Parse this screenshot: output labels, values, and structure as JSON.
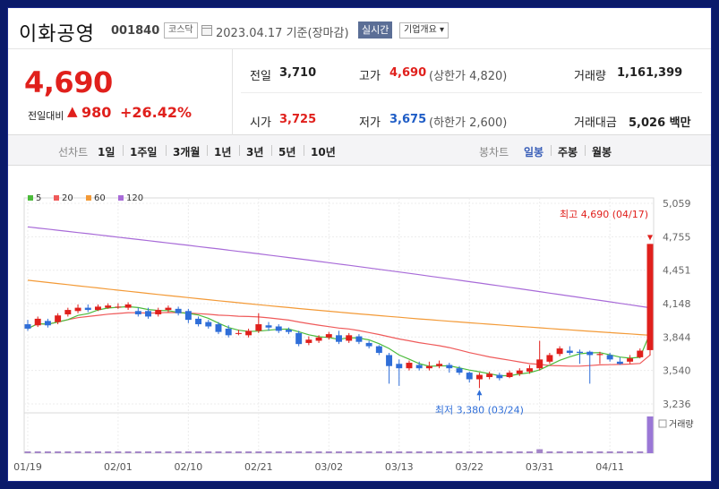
{
  "header": {
    "company": "이화공영",
    "code": "001840",
    "market": "코스닥",
    "date": "2023.04.17",
    "basis": "기준(장마감)",
    "realtime": "실시간",
    "overview": "기업개요 ▾"
  },
  "quote": {
    "price": "4,690",
    "change_label": "전일대비",
    "change_arrow": "▲",
    "change": "980",
    "change_pct": "+26.42%",
    "prev_label": "전일",
    "prev": "3,710",
    "open_label": "시가",
    "open": "3,725",
    "high_label": "고가",
    "high": "4,690",
    "upper_limit": "(상한가 4,820)",
    "low_label": "저가",
    "low": "3,675",
    "lower_limit": "(하한가 2,600)",
    "volume_label": "거래량",
    "volume": "1,161,399",
    "amount_label": "거래대금",
    "amount": "5,026",
    "amount_unit": "백만"
  },
  "periods": {
    "line_label": "선차트",
    "line_items": [
      "1일",
      "1주일",
      "3개월",
      "1년",
      "3년",
      "5년",
      "10년"
    ],
    "candle_label": "봉차트",
    "candle_items": [
      "일봉",
      "주봉",
      "월봉"
    ],
    "active_candle": "일봉"
  },
  "colors": {
    "up": "#e0201c",
    "down": "#2f6ed8",
    "ma5": "#4cbb3b",
    "ma20": "#ef5a5a",
    "ma60": "#f39a37",
    "ma120": "#a86bd8",
    "volume": "#a486c8",
    "volume_last": "#9a77d6"
  },
  "chart_data": {
    "type": "candlestick",
    "legend": [
      {
        "label": "5",
        "color": "#4cbb3b"
      },
      {
        "label": "20",
        "color": "#ef5a5a"
      },
      {
        "label": "60",
        "color": "#f39a37"
      },
      {
        "label": "120",
        "color": "#a86bd8"
      }
    ],
    "y_ticks": [
      "5,059",
      "4,755",
      "4,451",
      "4,148",
      "3,844",
      "3,540",
      "3,236"
    ],
    "y_tick_values": [
      5059,
      4755,
      4451,
      4148,
      3844,
      3540,
      3236
    ],
    "x_ticks": [
      "01/19",
      "02/01",
      "02/10",
      "02/21",
      "03/02",
      "03/13",
      "03/22",
      "03/31",
      "04/11"
    ],
    "x_tick_index": [
      0,
      9,
      16,
      23,
      30,
      37,
      44,
      51,
      58
    ],
    "volume_label": "거래량",
    "max_label": "최고 4,690 (04/17)",
    "min_label": "최저 3,380 (03/24)",
    "max_index": 62,
    "min_index": 45,
    "candles": [
      [
        3960,
        3920,
        4000,
        3900
      ],
      [
        3950,
        4010,
        4030,
        3935
      ],
      [
        3990,
        3950,
        4010,
        3930
      ],
      [
        3980,
        4040,
        4060,
        3960
      ],
      [
        4050,
        4090,
        4110,
        4030
      ],
      [
        4080,
        4110,
        4140,
        4060
      ],
      [
        4110,
        4090,
        4140,
        4070
      ],
      [
        4090,
        4120,
        4140,
        4080
      ],
      [
        4110,
        4130,
        4150,
        4100
      ],
      [
        4120,
        4120,
        4150,
        4100
      ],
      [
        4110,
        4140,
        4160,
        4090
      ],
      [
        4080,
        4050,
        4110,
        4030
      ],
      [
        4080,
        4030,
        4110,
        4010
      ],
      [
        4050,
        4090,
        4110,
        4030
      ],
      [
        4090,
        4110,
        4130,
        4070
      ],
      [
        4100,
        4060,
        4120,
        4040
      ],
      [
        4080,
        4000,
        4100,
        3970
      ],
      [
        4010,
        3960,
        4030,
        3940
      ],
      [
        3980,
        3940,
        4000,
        3920
      ],
      [
        3960,
        3890,
        3980,
        3870
      ],
      [
        3920,
        3860,
        3950,
        3840
      ],
      [
        3880,
        3880,
        3910,
        3860
      ],
      [
        3860,
        3900,
        3920,
        3840
      ],
      [
        3900,
        3960,
        4060,
        3880
      ],
      [
        3950,
        3930,
        3980,
        3900
      ],
      [
        3940,
        3900,
        3960,
        3880
      ],
      [
        3910,
        3890,
        3930,
        3870
      ],
      [
        3880,
        3780,
        3900,
        3760
      ],
      [
        3790,
        3820,
        3850,
        3770
      ],
      [
        3810,
        3840,
        3860,
        3790
      ],
      [
        3840,
        3870,
        3890,
        3820
      ],
      [
        3860,
        3800,
        3900,
        3780
      ],
      [
        3810,
        3860,
        3880,
        3790
      ],
      [
        3850,
        3800,
        3870,
        3780
      ],
      [
        3790,
        3760,
        3810,
        3740
      ],
      [
        3760,
        3700,
        3770,
        3680
      ],
      [
        3680,
        3580,
        3700,
        3420
      ],
      [
        3600,
        3560,
        3640,
        3400
      ],
      [
        3560,
        3610,
        3630,
        3540
      ],
      [
        3590,
        3560,
        3620,
        3540
      ],
      [
        3560,
        3580,
        3620,
        3540
      ],
      [
        3580,
        3600,
        3630,
        3560
      ],
      [
        3590,
        3560,
        3610,
        3520
      ],
      [
        3560,
        3520,
        3580,
        3500
      ],
      [
        3520,
        3460,
        3530,
        3430
      ],
      [
        3460,
        3500,
        3520,
        3380
      ],
      [
        3480,
        3510,
        3530,
        3460
      ],
      [
        3500,
        3470,
        3520,
        3450
      ],
      [
        3480,
        3520,
        3540,
        3470
      ],
      [
        3510,
        3540,
        3560,
        3490
      ],
      [
        3530,
        3560,
        3590,
        3510
      ],
      [
        3560,
        3640,
        3810,
        3540
      ],
      [
        3620,
        3680,
        3700,
        3600
      ],
      [
        3690,
        3740,
        3760,
        3670
      ],
      [
        3720,
        3700,
        3760,
        3680
      ],
      [
        3710,
        3700,
        3730,
        3600
      ],
      [
        3710,
        3680,
        3720,
        3420
      ],
      [
        3680,
        3690,
        3710,
        3600
      ],
      [
        3680,
        3640,
        3700,
        3620
      ],
      [
        3620,
        3600,
        3660,
        3590
      ],
      [
        3620,
        3650,
        3680,
        3600
      ],
      [
        3660,
        3720,
        3740,
        3650
      ],
      [
        3725,
        4690,
        4690,
        3675
      ]
    ],
    "volumes": [
      12,
      10,
      14,
      18,
      15,
      11,
      16,
      12,
      10,
      13,
      12,
      11,
      12,
      10,
      9,
      10,
      12,
      11,
      10,
      12,
      11,
      10,
      12,
      16,
      13,
      11,
      10,
      14,
      12,
      10,
      11,
      12,
      10,
      13,
      12,
      14,
      22,
      18,
      12,
      11,
      10,
      11,
      12,
      13,
      15,
      12,
      10,
      11,
      12,
      14,
      13,
      45,
      14,
      12,
      11,
      10,
      13,
      12,
      11,
      12,
      14,
      16,
      420
    ],
    "ma5_end": 3880,
    "ma20_end": 3680,
    "ma60_end": 3860,
    "ma120_end": 4110
  }
}
